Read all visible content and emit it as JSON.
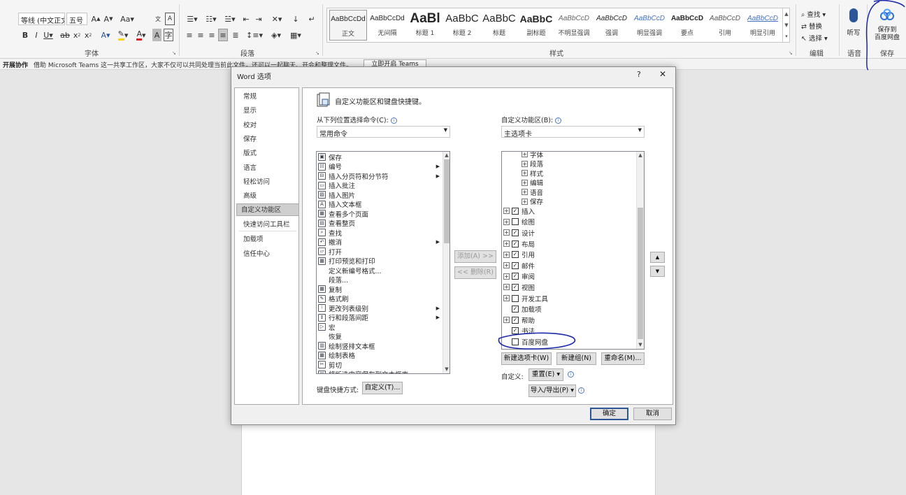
{
  "ribbon": {
    "font": {
      "family": "等线 (中文正文",
      "size": "五号",
      "label": "字体"
    },
    "paragraph": {
      "label": "段落"
    },
    "styles": {
      "label": "样式",
      "items": [
        {
          "sample": "AaBbCcDd",
          "name": "正文"
        },
        {
          "sample": "AaBbCcDd",
          "name": "无间隔"
        },
        {
          "sample": "AaBl",
          "name": "标题 1"
        },
        {
          "sample": "AaBbC",
          "name": "标题 2"
        },
        {
          "sample": "AaBbC",
          "name": "标题"
        },
        {
          "sample": "AaBbC",
          "name": "副标题"
        },
        {
          "sample": "AaBbCcD",
          "name": "不明显强调"
        },
        {
          "sample": "AaBbCcD",
          "name": "强调"
        },
        {
          "sample": "AaBbCcD",
          "name": "明显强调"
        },
        {
          "sample": "AaBbCcD",
          "name": "要点"
        },
        {
          "sample": "AaBbCcD",
          "name": "引用"
        },
        {
          "sample": "AaBbCcD",
          "name": "明显引用"
        }
      ]
    },
    "editing": {
      "find": "查找",
      "replace": "替换",
      "select": "选择",
      "label": "编辑"
    },
    "voice": {
      "dictate": "听写",
      "label": "语音"
    },
    "save": {
      "line1": "保存到",
      "line2": "百度网盘",
      "label": "保存"
    }
  },
  "collab": {
    "title": "开展协作",
    "text": "借助 Microsoft Teams 这一共享工作区，大家不仅可以共同处理当前此文件，还可以一起聊天、开会和整理文件。",
    "button": "立即开启 Teams"
  },
  "dialog": {
    "title": "Word 选项",
    "help": "?",
    "close": "✕",
    "nav": [
      "常规",
      "显示",
      "校对",
      "保存",
      "版式",
      "语言",
      "轻松访问",
      "高级",
      "自定义功能区",
      "快速访问工具栏",
      "加载项",
      "信任中心"
    ],
    "active_nav": "自定义功能区",
    "heading": "自定义功能区和键盘快捷键。",
    "choose_label": "从下列位置选择命令(C):",
    "choose_value": "常用命令",
    "customize_label": "自定义功能区(B):",
    "customize_value": "主选项卡",
    "commands": [
      "保存",
      "编号",
      "插入分页符和分节符",
      "插入批注",
      "插入图片",
      "插入文本框",
      "查看多个页面",
      "查看整页",
      "查找",
      "撤消",
      "打开",
      "打印预览和打印",
      "定义新编号格式...",
      "段落...",
      "复制",
      "格式刷",
      "更改列表级别",
      "行和段落间距",
      "宏",
      "恢复",
      "绘制竖排文本框",
      "绘制表格",
      "剪切",
      "将所选内容保存到文本框库"
    ],
    "tree_groups": [
      "字体",
      "段落",
      "样式",
      "编辑",
      "语音",
      "保存"
    ],
    "tree_tabs": [
      {
        "label": "插入",
        "checked": true,
        "expand": true
      },
      {
        "label": "绘图",
        "checked": false,
        "expand": true
      },
      {
        "label": "设计",
        "checked": true,
        "expand": true
      },
      {
        "label": "布局",
        "checked": true,
        "expand": true
      },
      {
        "label": "引用",
        "checked": true,
        "expand": true
      },
      {
        "label": "邮件",
        "checked": true,
        "expand": true
      },
      {
        "label": "审阅",
        "checked": true,
        "expand": true
      },
      {
        "label": "视图",
        "checked": true,
        "expand": true
      },
      {
        "label": "开发工具",
        "checked": false,
        "expand": true
      },
      {
        "label": "加载项",
        "checked": true,
        "expand": false
      },
      {
        "label": "帮助",
        "checked": true,
        "expand": true
      },
      {
        "label": "书法",
        "checked": true,
        "expand": false
      },
      {
        "label": "百度网盘",
        "checked": false,
        "expand": false
      }
    ],
    "add_button": "添加(A) >>",
    "remove_button": "<< 删除(R)",
    "new_tab_button": "新建选项卡(W)",
    "new_group_button": "新建组(N)",
    "rename_button": "重命名(M)...",
    "customizations_label": "自定义:",
    "reset_button": "重置(E) ▾",
    "import_export_button": "导入/导出(P) ▾",
    "keyboard_label": "键盘快捷方式:",
    "keyboard_button": "自定义(T)...",
    "ok_button": "确定",
    "cancel_button": "取消"
  },
  "colors": {
    "annotation": "#1b2aa8",
    "accent": "#2b579a"
  }
}
